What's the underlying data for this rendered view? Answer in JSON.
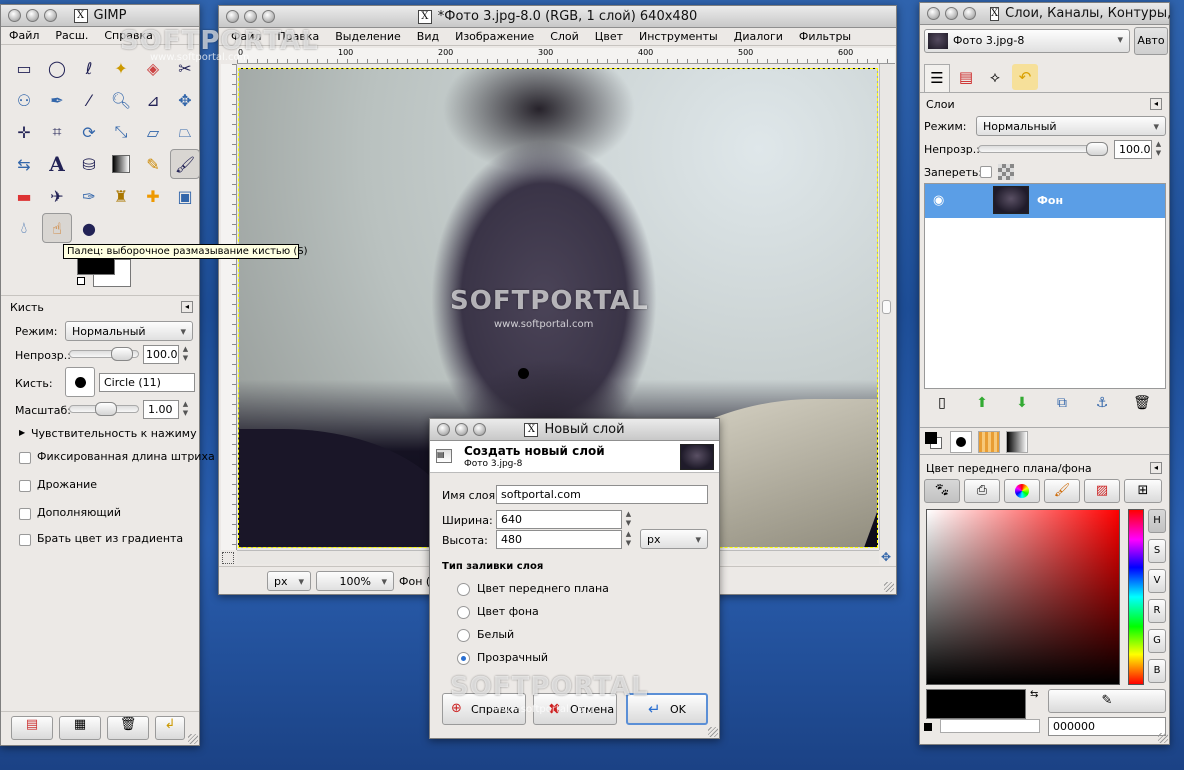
{
  "toolbox": {
    "title": "GIMP",
    "menu": [
      "Файл",
      "Расш.",
      "Справка"
    ],
    "tooltip": "Палец: выборочное размазывание кистью  (S)",
    "panel_title": "Кисть",
    "mode_label": "Режим:",
    "mode_value": "Нормальный",
    "opacity_label": "Непрозр.:",
    "opacity_value": "100.0",
    "brush_label": "Кисть:",
    "brush_value": "Circle (11)",
    "scale_label": "Масштаб:",
    "scale_value": "1.00",
    "pressure_label": "Чувствительность к нажиму",
    "options": [
      "Фиксированная длина штриха",
      "Дрожание",
      "Дополняющий",
      "Брать цвет из градиента"
    ]
  },
  "image_window": {
    "title": "*Фото 3.jpg-8.0 (RGB, 1 слой) 640x480",
    "menu": [
      "Файл",
      "Правка",
      "Выделение",
      "Вид",
      "Изображение",
      "Слой",
      "Цвет",
      "Инструменты",
      "Диалоги",
      "Фильтры"
    ],
    "ruler": [
      "0",
      "100",
      "200",
      "300",
      "400",
      "500",
      "600"
    ],
    "unit": "px",
    "zoom": "100%",
    "status": "Фон (1"
  },
  "layers_window": {
    "title": "Слои, Каналы, Контуры,",
    "image_select": "Фото 3.jpg-8",
    "auto_label": "Авто",
    "section": "Слои",
    "mode_label": "Режим:",
    "mode_value": "Нормальный",
    "opacity_label": "Непрозр.:",
    "opacity_value": "100.0",
    "lock_label": "Запереть:",
    "layer_name": "Фон",
    "color_section": "Цвет переднего плана/фона",
    "channels": [
      "H",
      "S",
      "V",
      "R",
      "G",
      "B"
    ],
    "hex_value": "000000"
  },
  "dialog": {
    "title": "Новый слой",
    "heading": "Создать новый слой",
    "subheading": "Фото 3.jpg-8",
    "name_label": "Имя слоя:",
    "name_value": "softportal.com",
    "width_label": "Ширина:",
    "width_value": "640",
    "height_label": "Высота:",
    "height_value": "480",
    "unit": "px",
    "fill_label": "Тип заливки слоя",
    "fill_options": [
      "Цвет переднего плана",
      "Цвет фона",
      "Белый",
      "Прозрачный"
    ],
    "selected_fill": "Прозрачный",
    "help_label": "Справка",
    "cancel_label": "Отмена",
    "ok_label": "OK"
  },
  "watermark": {
    "brand": "SOFTPORTAL",
    "url": "www.softportal.com"
  },
  "colors": {
    "accent": "#5b9ee6",
    "foreground": "#000000"
  }
}
